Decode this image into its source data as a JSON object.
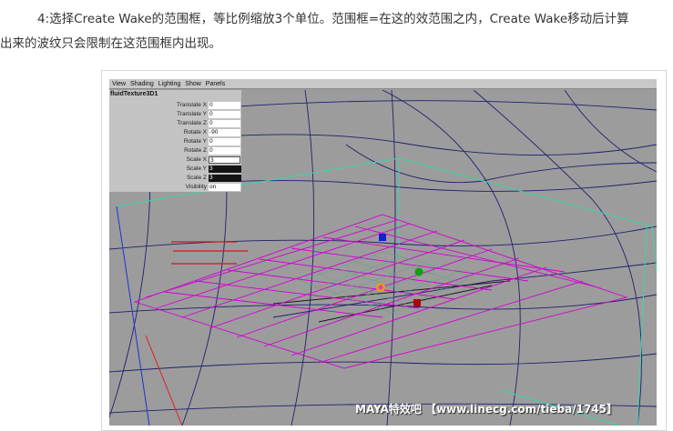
{
  "article": {
    "line1": "4:选择Create Wake的范围框，等比例缩放3个单位。范围框=在这的效范围之内，Create Wake移动后计算",
    "line2": "出来的波纹只会限制在这范围框内出现。"
  },
  "maya": {
    "menu": [
      "View",
      "Shading",
      "Lighting",
      "Show",
      "Panels"
    ],
    "channel_box": {
      "node_name": "fluidTexture3D1",
      "attributes": [
        {
          "label": "Translate X",
          "value": "0"
        },
        {
          "label": "Translate Y",
          "value": "0"
        },
        {
          "label": "Translate Z",
          "value": "0"
        },
        {
          "label": "Rotate X",
          "value": "-90"
        },
        {
          "label": "Rotate Y",
          "value": "0"
        },
        {
          "label": "Rotate Z",
          "value": "0"
        },
        {
          "label": "Scale X",
          "value": "3"
        },
        {
          "label": "Scale Y",
          "value": "3"
        },
        {
          "label": "Scale Z",
          "value": "3"
        },
        {
          "label": "Visibility",
          "value": "on"
        }
      ]
    },
    "watermark": "MAYA特效吧 【www.linecg.com/tieba/1745】"
  },
  "colors": {
    "viewport_bg": "#9c9c9c",
    "ocean_grid": "#20206e",
    "container_box": "#3ad6a8",
    "wake_grid": "#d400d4",
    "annotation": "#d01a1a"
  }
}
